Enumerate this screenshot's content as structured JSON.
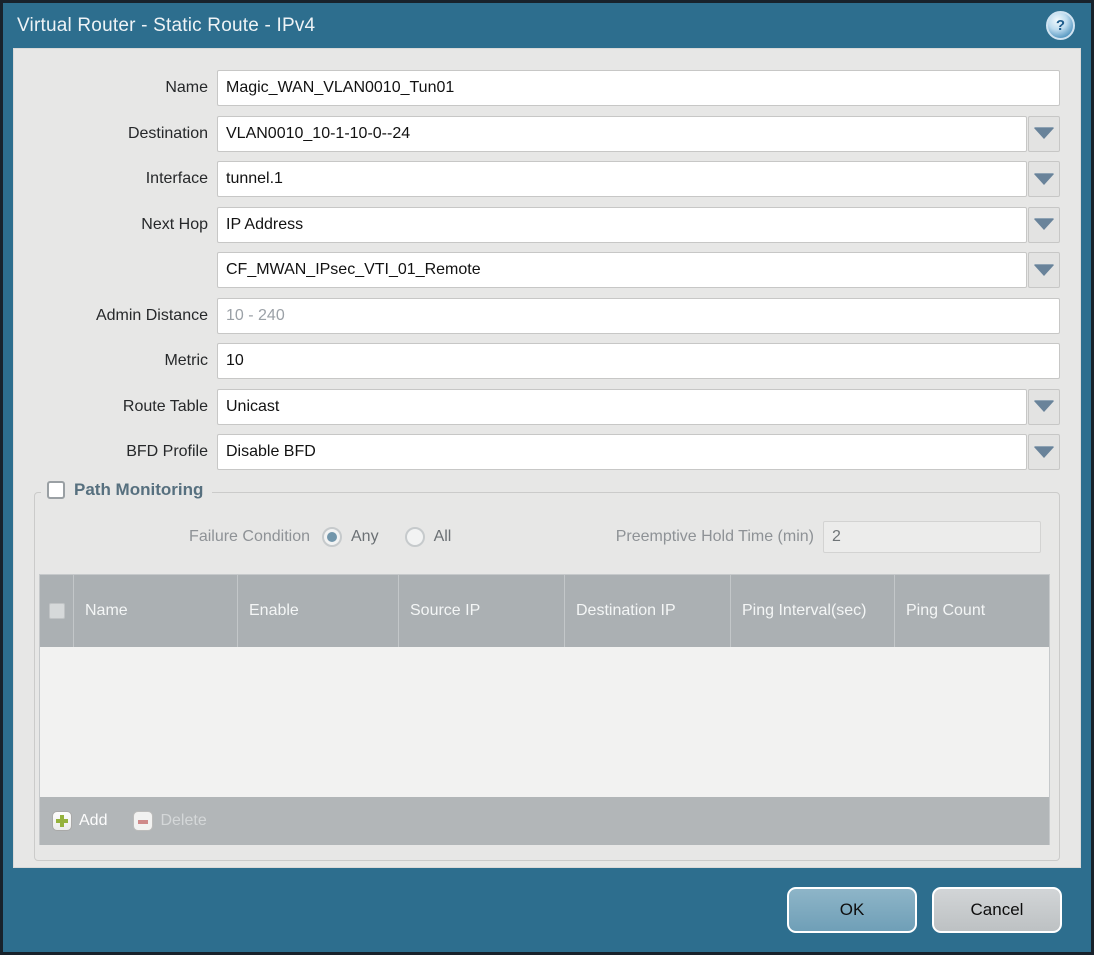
{
  "titlebar": {
    "title": "Virtual Router - Static Route - IPv4"
  },
  "form": {
    "fields": [
      {
        "label": "Name",
        "value": "Magic_WAN_VLAN0010_Tun01",
        "type": "text"
      },
      {
        "label": "Destination",
        "value": "VLAN0010_10-1-10-0--24",
        "type": "dropdown"
      },
      {
        "label": "Interface",
        "value": "tunnel.1",
        "type": "dropdown"
      },
      {
        "label": "Next Hop",
        "value": "IP Address",
        "type": "dropdown"
      },
      {
        "label": "",
        "value": "CF_MWAN_IPsec_VTI_01_Remote",
        "type": "dropdown"
      },
      {
        "label": "Admin Distance",
        "value": "",
        "placeholder": "10 - 240",
        "type": "text"
      },
      {
        "label": "Metric",
        "value": "10",
        "type": "text"
      },
      {
        "label": "Route Table",
        "value": "Unicast",
        "type": "dropdown"
      },
      {
        "label": "BFD Profile",
        "value": "Disable BFD",
        "type": "dropdown"
      }
    ]
  },
  "path_monitoring": {
    "title": "Path Monitoring",
    "checkbox_checked": false,
    "failure_condition_label": "Failure Condition",
    "options": [
      {
        "label": "Any",
        "selected": true
      },
      {
        "label": "All",
        "selected": false
      }
    ],
    "hold_time_label": "Preemptive Hold Time (min)",
    "hold_time_value": "2",
    "table": {
      "columns": [
        "Name",
        "Enable",
        "Source IP",
        "Destination IP",
        "Ping Interval(sec)",
        "Ping Count"
      ],
      "rows": []
    },
    "toolbar": {
      "add_label": "Add",
      "delete_label": "Delete",
      "delete_enabled": false
    }
  },
  "footer": {
    "ok_label": "OK",
    "cancel_label": "Cancel"
  },
  "colors": {
    "titlebar_teal": "#2d6e8e",
    "content_bg": "#e7e7e6",
    "table_header_gray": "#abb0b3",
    "ok_button_blue": "#7fa9bf",
    "cancel_button_gray": "#c5c9cb",
    "add_icon_green": "#95b23c",
    "delete_icon_red": "#cf8a8a",
    "dropdown_arrow": "#69839a"
  }
}
